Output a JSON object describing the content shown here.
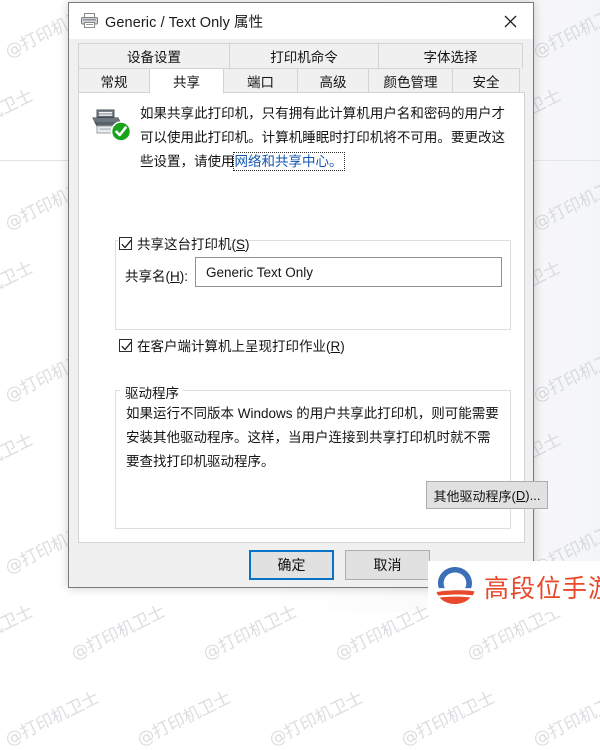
{
  "window": {
    "title": "Generic / Text Only 属性",
    "icon": "printer-icon",
    "close_label": "×"
  },
  "tabs": {
    "top_row": [
      {
        "label": "设备设置",
        "selected": false
      },
      {
        "label": "打印机命令",
        "selected": false
      },
      {
        "label": "字体选择",
        "selected": false
      }
    ],
    "bottom_row": [
      {
        "label": "常规",
        "selected": false
      },
      {
        "label": "共享",
        "selected": true
      },
      {
        "label": "端口",
        "selected": false
      },
      {
        "label": "高级",
        "selected": false
      },
      {
        "label": "颜色管理",
        "selected": false
      },
      {
        "label": "安全",
        "selected": false
      }
    ]
  },
  "info": {
    "icon": "printer-shared-ok-icon",
    "text_before_link": "如果共享此打印机，只有拥有此计算机用户名和密码的用户才可以使用此打印机。计算机睡眠时打印机将不可用。要更改这些设置，请使用",
    "link_label": "网络和共享中心。"
  },
  "share_section": {
    "share_this_printer": {
      "label": "共享这台打印机(S)",
      "label_plain": "共享这台打印机(",
      "accel": "S",
      "label_tail": ")",
      "checked": true
    },
    "share_name": {
      "label_plain": "共享名(",
      "accel": "H",
      "label_tail": "):",
      "value": "Generic  Text Only",
      "placeholder": ""
    },
    "render_jobs": {
      "label_plain": "在客户端计算机上呈现打印作业(",
      "accel": "R",
      "label_tail": ")",
      "checked": true
    }
  },
  "driver_section": {
    "legend": "驱动程序",
    "description": "如果运行不同版本 Windows 的用户共享此打印机，则可能需要安装其他驱动程序。这样，当用户连接到共享打印机时就不需要查找打印机驱动程序。",
    "button": {
      "label_plain": "其他驱动程序(",
      "accel": "D",
      "label_tail": ")..."
    }
  },
  "footer": {
    "ok_label": "确定",
    "cancel_label": "取消"
  },
  "brand": {
    "name": "高段位手游网",
    "logo": "circle-swoosh-logo",
    "accent_color": "#e8492a",
    "logo_blue": "#3b6fb6"
  },
  "watermark": {
    "text": "@打印机卫士"
  },
  "colors": {
    "dialog_bg": "#f0f0f0",
    "panel_bg": "#ffffff",
    "focus_blue": "#0a71c8",
    "link_blue": "#1356b0",
    "button_face": "#e1e1e1",
    "status_green": "#19a319"
  }
}
